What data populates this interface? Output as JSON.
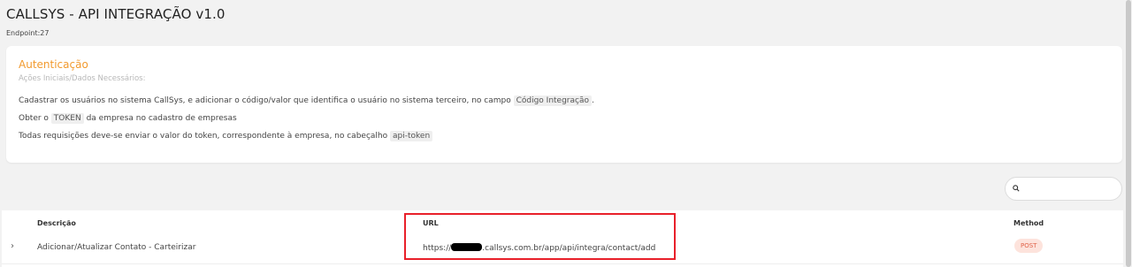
{
  "page": {
    "title": "CALLSYS - API INTEGRAÇÃO v1.0",
    "endpoint": "Endpoint:27"
  },
  "auth_card": {
    "title": "Autenticação",
    "subtitle": "Ações Iniciais/Dados Necessários:",
    "line1_pre": "Cadastrar os usuários no sistema CallSys, e adicionar o código/valor que identifica o usuário no sistema terceiro, no campo ",
    "line1_code": "Código Integração",
    "line1_post": ".",
    "line2_pre": "Obter o ",
    "line2_code": "TOKEN",
    "line2_post": " da empresa no cadastro de empresas",
    "line3_pre": "Todas requisições deve-se enviar o valor do token, correspondente à empresa, no cabeçalho ",
    "line3_code": "api-token"
  },
  "table": {
    "columns": {
      "description": "Descrição",
      "url": "URL",
      "method": "Method"
    },
    "rows": [
      {
        "expand_glyph": "›",
        "description": "Adicionar/Atualizar Contato - Carteirizar",
        "url_prefix": "https://",
        "url_suffix": ".callsys.com.br/app/api/integra/contact/add",
        "method": "POST"
      }
    ]
  },
  "colors": {
    "accent": "#f29a2e",
    "highlight_border": "#e8202a",
    "method_badge_bg": "#fde3dc",
    "method_badge_fg": "#e0634a"
  }
}
